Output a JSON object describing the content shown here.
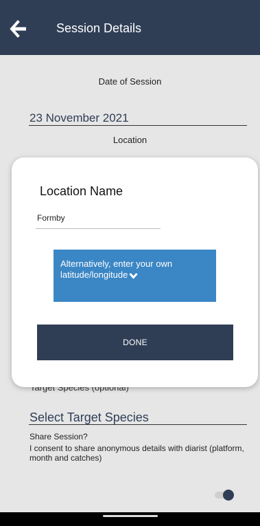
{
  "header": {
    "title": "Session Details",
    "back_icon": "back-arrow-icon",
    "background": "#2f3e55"
  },
  "form": {
    "date_caption": "Date of Session",
    "date_value": "23 November 2021",
    "location_caption": "Location",
    "target_species_caption": "Target Species (optional)",
    "target_species_value": "Select Target Species",
    "share_title": "Share Session?",
    "share_description": "I consent to share anonymous details with diarist (platform, month and catches)",
    "share_enabled": true
  },
  "dialog": {
    "heading": "Location Name",
    "location_value": "Formby",
    "alternative_text": "Alternatively, enter your own latitude/longitude",
    "alternative_icon": "chevron-down-icon",
    "done_label": "DONE"
  },
  "colors": {
    "primary": "#2f3e55",
    "accent": "#3b86c4",
    "background": "#e6e6e6"
  }
}
